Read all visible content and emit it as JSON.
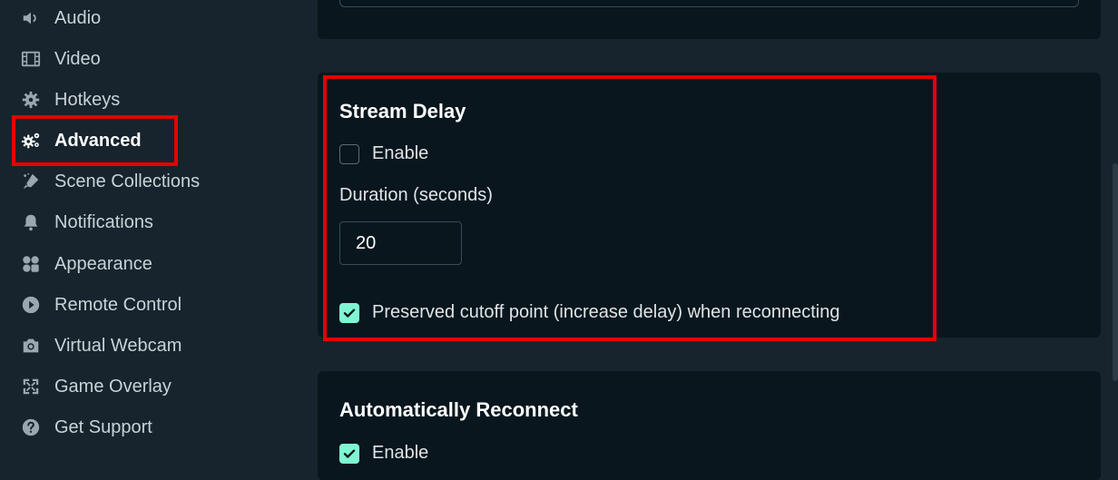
{
  "sidebar": {
    "items": [
      {
        "label": "Audio",
        "icon": "speaker-icon"
      },
      {
        "label": "Video",
        "icon": "film-icon"
      },
      {
        "label": "Hotkeys",
        "icon": "gear-icon"
      },
      {
        "label": "Advanced",
        "icon": "gears-icon",
        "active": true
      },
      {
        "label": "Scene Collections",
        "icon": "paint-icon"
      },
      {
        "label": "Notifications",
        "icon": "bell-icon"
      },
      {
        "label": "Appearance",
        "icon": "palette-icon"
      },
      {
        "label": "Remote Control",
        "icon": "play-circle-icon"
      },
      {
        "label": "Virtual Webcam",
        "icon": "camera-icon"
      },
      {
        "label": "Game Overlay",
        "icon": "expand-icon"
      },
      {
        "label": "Get Support",
        "icon": "question-icon"
      }
    ]
  },
  "stream_delay": {
    "title": "Stream Delay",
    "enable_label": "Enable",
    "enable_checked": false,
    "duration_label": "Duration (seconds)",
    "duration_value": "20",
    "preserve_label": "Preserved cutoff point (increase delay) when reconnecting",
    "preserve_checked": true
  },
  "auto_reconnect": {
    "title": "Automatically Reconnect",
    "enable_label": "Enable",
    "enable_checked": true
  },
  "colors": {
    "accent": "#80f5d2",
    "highlight": "#e60000",
    "background": "#17242d",
    "card": "#09161d"
  }
}
